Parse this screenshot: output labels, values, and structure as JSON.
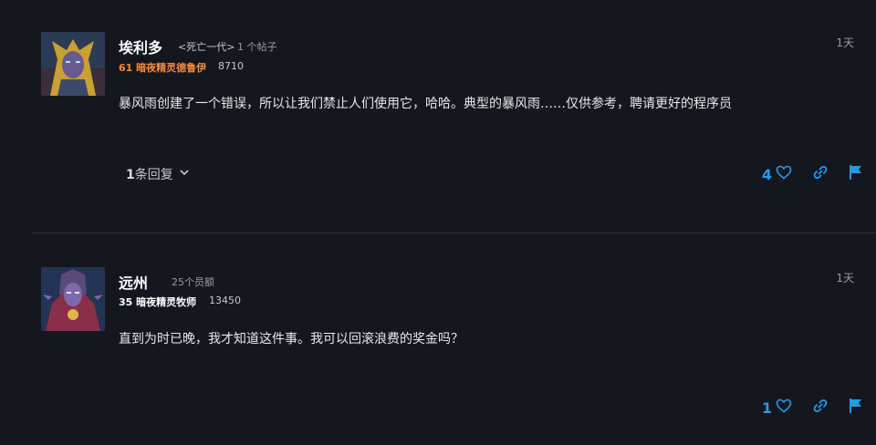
{
  "posts": [
    {
      "author": "埃利多",
      "title_tag": "<死亡一代>",
      "post_count": "1 个帖子",
      "character": "61 暗夜精灵德鲁伊",
      "score": "8710",
      "time": "1天",
      "body": "暴风雨创建了一个错误，所以让我们禁止人们使用它，哈哈。典型的暴风雨……仅供参考，聘请更好的程序员",
      "replies": {
        "count": "1",
        "label": "条回复"
      },
      "likes": "4"
    },
    {
      "author": "远州",
      "post_count": "25个员额",
      "character": "35 暗夜精灵牧师",
      "score": "13450",
      "time": "1天",
      "body": "直到为时已晚，我才知道这件事。我可以回滚浪费的奖金吗？",
      "likes": "1"
    }
  ],
  "colors": {
    "background": "#15171e",
    "accent": "#1e9bf0",
    "druid_orange": "#f58a3a"
  },
  "icons": [
    "heart-icon",
    "link-icon",
    "flag-icon",
    "chevron-down-icon"
  ]
}
